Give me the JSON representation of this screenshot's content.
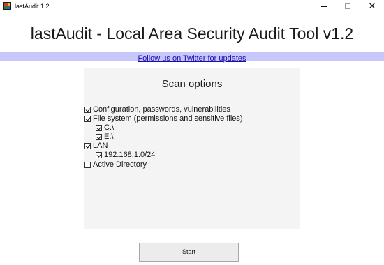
{
  "window": {
    "title": "lastAudit 1.2",
    "minimize_glyph": "—",
    "maximize_glyph": "☐",
    "close_glyph": "✕"
  },
  "header": {
    "title": "lastAudit - Local Area Security Audit Tool v1.2"
  },
  "banner": {
    "link_text": "Follow us on Twitter for updates",
    "background": "#c7c7fc",
    "link_color": "#1a0dab"
  },
  "scan_options": {
    "title": "Scan options",
    "options": [
      {
        "label": "Configuration, passwords, vulnerabilities",
        "checked": true,
        "level": 0
      },
      {
        "label": "File system (permissions and sensitive files)",
        "checked": true,
        "level": 0
      },
      {
        "label": "C:\\",
        "checked": true,
        "level": 1
      },
      {
        "label": "E:\\",
        "checked": true,
        "level": 1
      },
      {
        "label": "LAN",
        "checked": true,
        "level": 0
      },
      {
        "label": "192.168.1.0/24",
        "checked": true,
        "level": 1
      },
      {
        "label": "Active Directory",
        "checked": false,
        "level": 0
      }
    ]
  },
  "actions": {
    "start_label": "Start"
  },
  "icons": {
    "app": "app-logo-icon",
    "checkbox_checked": "checkbox-checked-icon",
    "checkbox_unchecked": "checkbox-unchecked-icon"
  }
}
